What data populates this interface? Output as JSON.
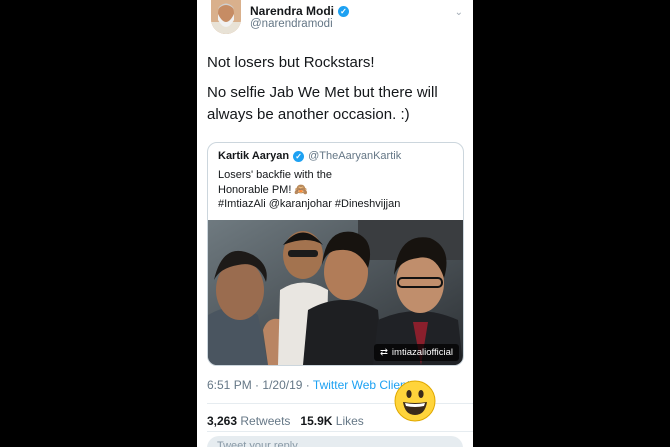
{
  "tweet": {
    "author_name": "Narendra Modi",
    "author_handle": "@narendramodi",
    "verified_glyph": "✓",
    "chevron_glyph": "⌄",
    "text_line1": "Not losers but Rockstars!",
    "text_line2": "No selfie Jab We Met but there will always be another occasion. :)",
    "quoted": {
      "author_name": "Kartik Aaryan",
      "author_handle": "@TheAaryanKartik",
      "text_line1": "Losers' backfie with the",
      "text_line2": "Honorable PM! 🙈",
      "text_line3": "#ImtiazAli @karanjohar #Dineshvijjan",
      "photo_credit": "imtiazaliofficial"
    },
    "time": "6:51 PM",
    "separator": "·",
    "date": "1/20/19",
    "client": "Twitter Web Client",
    "retweets_count": "3,263",
    "retweets_label": "Retweets",
    "likes_count": "15.9K",
    "likes_label": "Likes",
    "reply_placeholder": "Tweet your reply"
  },
  "overlay_emoji": "grinning-face-emoji",
  "colors": {
    "accent": "#1da1f2",
    "text": "#14171a",
    "muted": "#657786",
    "background": "#000000",
    "card": "#ffffff"
  }
}
